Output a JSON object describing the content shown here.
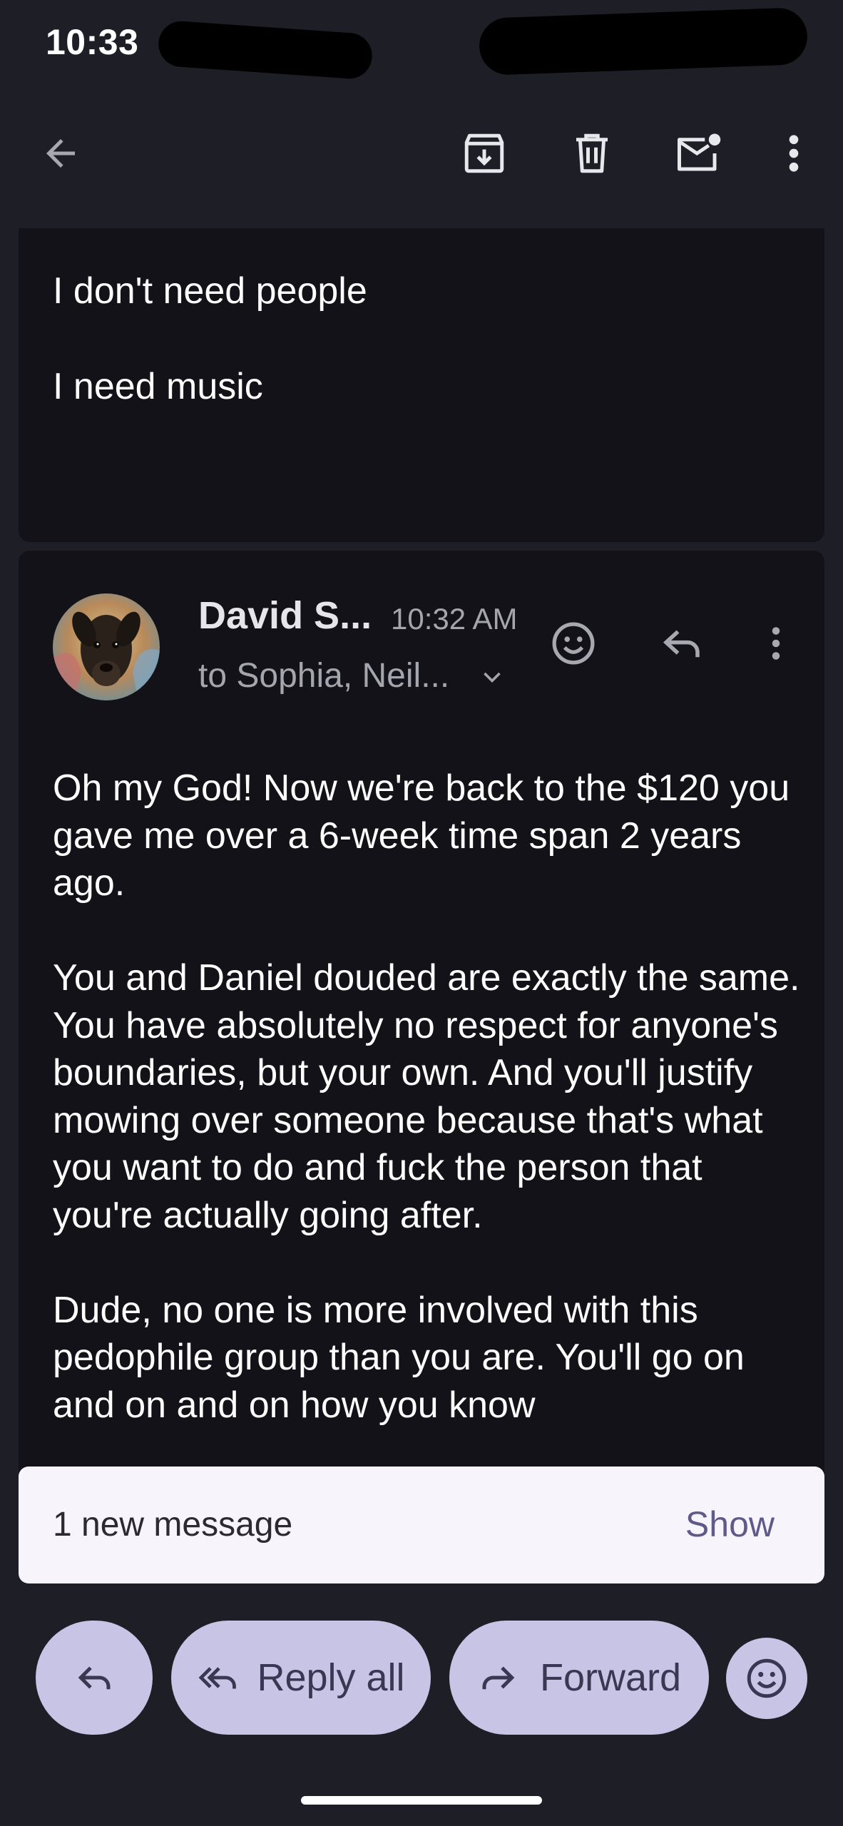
{
  "status_bar": {
    "time": "10:33"
  },
  "toolbar": {
    "back_icon": "arrow-back-icon",
    "archive_icon": "archive-icon",
    "delete_icon": "delete-icon",
    "mark_unread_icon": "mark-unread-icon",
    "more_icon": "more-vert-icon"
  },
  "previous_message": {
    "lines": [
      "I don't need people",
      "I need music"
    ]
  },
  "message": {
    "sender": "David S...",
    "time": "10:32 AM",
    "recipients": "to Sophia, Neil...",
    "paragraphs": [
      "Oh my God! Now we're back to the $120 you gave me over a 6-week time span 2 years ago.",
      "You and Daniel douded are exactly the same. You have absolutely no respect for anyone's boundaries, but your own. And you'll justify mowing over someone because that's what you want to do and fuck the person that you're actually going after.",
      "Dude, no one is more involved with this pedophile group than you are. You'll go on and on and on how you know"
    ]
  },
  "snackbar": {
    "text": "1 new message",
    "action": "Show"
  },
  "actions": {
    "reply_all": "Reply all",
    "forward": "Forward"
  },
  "colors": {
    "background": "#1e1e26",
    "card": "#121218",
    "pill": "#c8c4e6",
    "snackbar": "#f8f4fb",
    "accent_text": "#5e5a8a"
  }
}
